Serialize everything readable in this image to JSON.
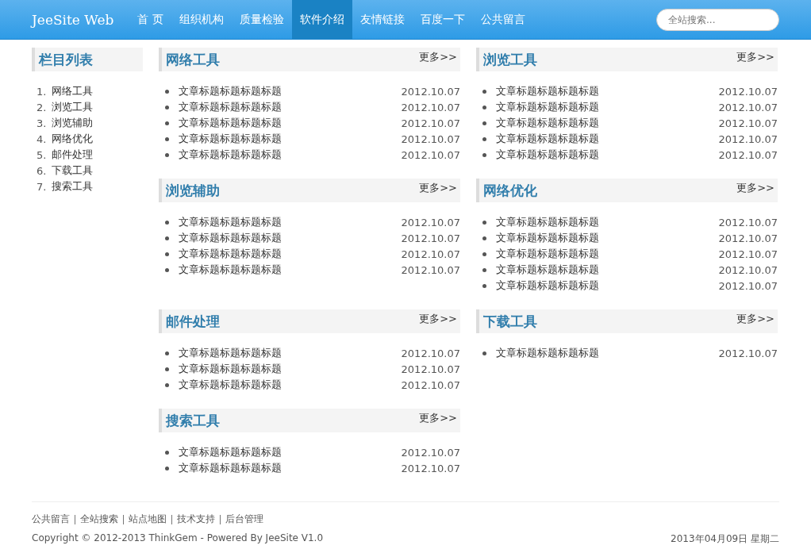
{
  "navbar": {
    "brand": "JeeSite Web",
    "items": [
      {
        "label": "首 页",
        "selected": false
      },
      {
        "label": "组织机构",
        "selected": false
      },
      {
        "label": "质量检验",
        "selected": false
      },
      {
        "label": "软件介绍",
        "selected": true
      },
      {
        "label": "友情链接",
        "selected": false
      },
      {
        "label": "百度一下",
        "selected": false
      },
      {
        "label": "公共留言",
        "selected": false
      }
    ],
    "search": {
      "placeholder": "全站搜索..."
    }
  },
  "sidebar": {
    "title": "栏目列表",
    "items": [
      {
        "number": "1.",
        "label": "网络工具"
      },
      {
        "number": "2.",
        "label": "浏览工具"
      },
      {
        "number": "3.",
        "label": "浏览辅助"
      },
      {
        "number": "4.",
        "label": "网络优化"
      },
      {
        "number": "5.",
        "label": "邮件处理"
      },
      {
        "number": "6.",
        "label": "下载工具"
      },
      {
        "number": "7.",
        "label": "搜索工具"
      }
    ]
  },
  "sections": [
    {
      "title": "网络工具",
      "more": "更多>>",
      "articles": [
        {
          "title": "文章标题标题标题标题",
          "date": "2012.10.07"
        },
        {
          "title": "文章标题标题标题标题",
          "date": "2012.10.07"
        },
        {
          "title": "文章标题标题标题标题",
          "date": "2012.10.07"
        },
        {
          "title": "文章标题标题标题标题",
          "date": "2012.10.07"
        },
        {
          "title": "文章标题标题标题标题",
          "date": "2012.10.07"
        }
      ]
    },
    {
      "title": "浏览工具",
      "more": "更多>>",
      "articles": [
        {
          "title": "文章标题标题标题标题",
          "date": "2012.10.07"
        },
        {
          "title": "文章标题标题标题标题",
          "date": "2012.10.07"
        },
        {
          "title": "文章标题标题标题标题",
          "date": "2012.10.07"
        },
        {
          "title": "文章标题标题标题标题",
          "date": "2012.10.07"
        },
        {
          "title": "文章标题标题标题标题",
          "date": "2012.10.07"
        }
      ]
    },
    {
      "title": "浏览辅助",
      "more": "更多>>",
      "articles": [
        {
          "title": "文章标题标题标题标题",
          "date": "2012.10.07"
        },
        {
          "title": "文章标题标题标题标题",
          "date": "2012.10.07"
        },
        {
          "title": "文章标题标题标题标题",
          "date": "2012.10.07"
        },
        {
          "title": "文章标题标题标题标题",
          "date": "2012.10.07"
        }
      ]
    },
    {
      "title": "网络优化",
      "more": "更多>>",
      "articles": [
        {
          "title": "文章标题标题标题标题",
          "date": "2012.10.07"
        },
        {
          "title": "文章标题标题标题标题",
          "date": "2012.10.07"
        },
        {
          "title": "文章标题标题标题标题",
          "date": "2012.10.07"
        },
        {
          "title": "文章标题标题标题标题",
          "date": "2012.10.07"
        },
        {
          "title": "文章标题标题标题标题",
          "date": "2012.10.07"
        }
      ]
    },
    {
      "title": "邮件处理",
      "more": "更多>>",
      "articles": [
        {
          "title": "文章标题标题标题标题",
          "date": "2012.10.07"
        },
        {
          "title": "文章标题标题标题标题",
          "date": "2012.10.07"
        },
        {
          "title": "文章标题标题标题标题",
          "date": "2012.10.07"
        }
      ]
    },
    {
      "title": "下载工具",
      "more": "更多>>",
      "articles": [
        {
          "title": "文章标题标题标题标题",
          "date": "2012.10.07"
        }
      ]
    },
    {
      "title": "搜索工具",
      "more": "更多>>",
      "articles": [
        {
          "title": "文章标题标题标题标题",
          "date": "2012.10.07"
        },
        {
          "title": "文章标题标题标题标题",
          "date": "2012.10.07"
        }
      ]
    }
  ],
  "footer": {
    "links": [
      "公共留言",
      "全站搜索",
      "站点地图",
      "技术支持",
      "后台管理"
    ],
    "copyright": "Copyright © 2012-2013 ThinkGem - Powered By JeeSite V1.0",
    "date": "2013年04月09日 星期二"
  }
}
